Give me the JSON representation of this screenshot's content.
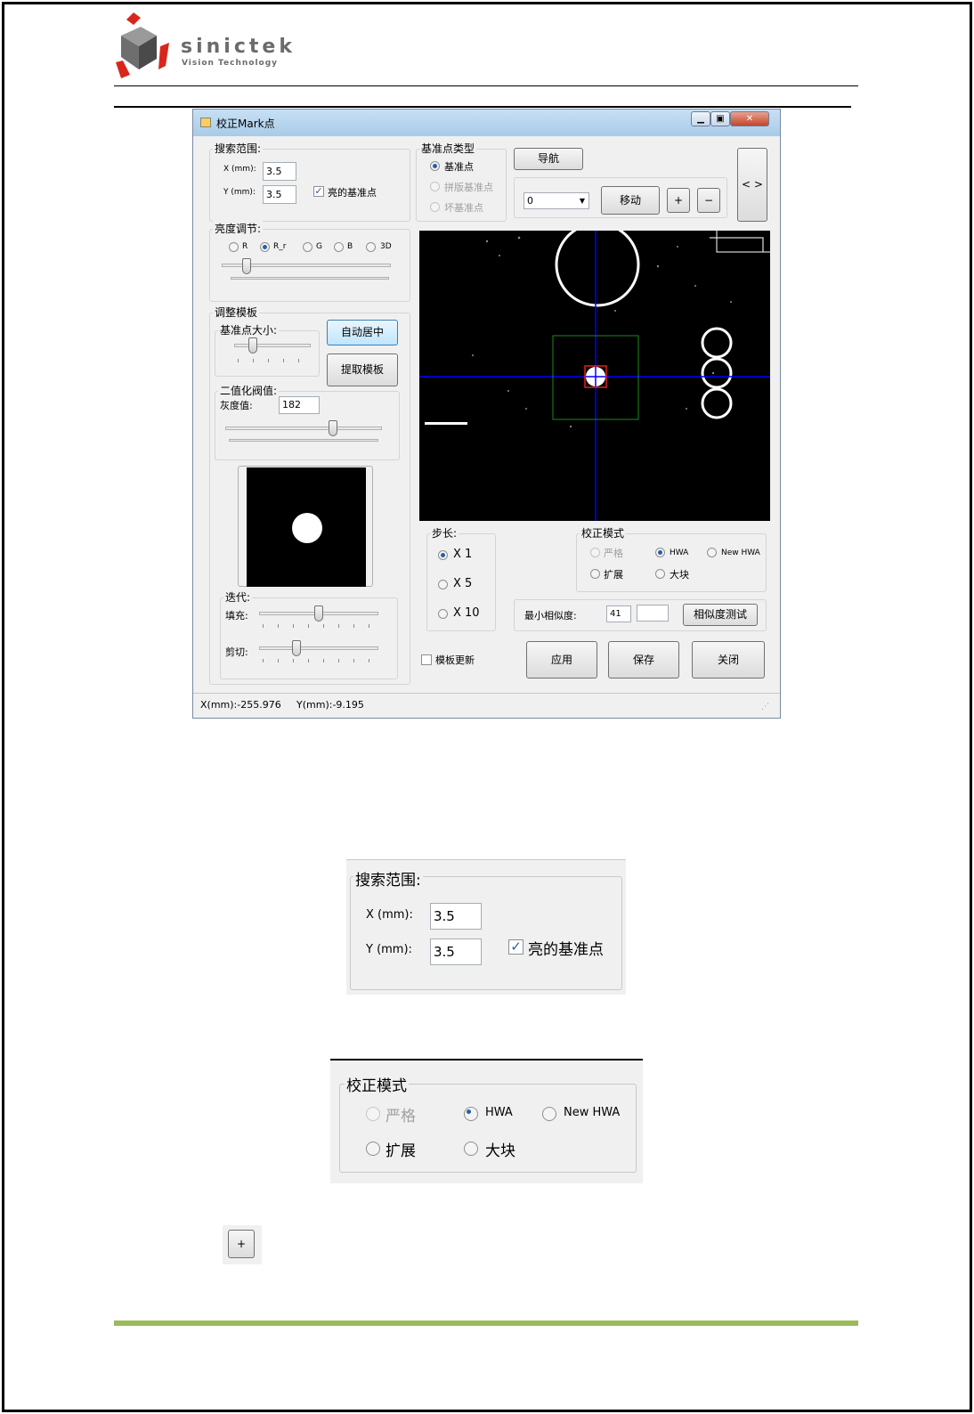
{
  "header": {
    "logo_name": "sinictek",
    "logo_tagline": "Vision Technology"
  },
  "window": {
    "title": "校正Mark点",
    "min_icon": "minimize-icon",
    "max_icon": "restore-icon",
    "close_icon": "close-icon"
  },
  "search_range": {
    "label": "搜索范围:",
    "x_label": "X (mm):",
    "x_value": "3.5",
    "y_label": "Y (mm):",
    "y_value": "3.5",
    "bright_label": "亮的基准点",
    "bright_checked": true
  },
  "fiducial_type": {
    "label": "基准点类型",
    "options": [
      "基准点",
      "拼版基准点",
      "坏基准点"
    ],
    "selected": "基准点"
  },
  "nav": {
    "navigate": "导航",
    "dropdown_value": "0",
    "move": "移动",
    "plus": "+",
    "minus": "−",
    "side_toggle": "< >"
  },
  "brightness": {
    "label": "亮度调节:",
    "options": [
      "R",
      "R_r",
      "G",
      "B",
      "3D"
    ],
    "selected": "R_r"
  },
  "template": {
    "label": "调整模板",
    "size_label": "基准点大小:",
    "auto_center": "自动居中",
    "extract": "提取模板",
    "binarize_label": "二值化阀值:",
    "gray_label": "灰度值:",
    "gray_value": "182",
    "iterate_label": "迭代:",
    "fill_label": "填充:",
    "cut_label": "剪切:"
  },
  "step": {
    "label": "步长:",
    "options": [
      "X 1",
      "X 5",
      "X 10"
    ],
    "selected": "X 1"
  },
  "correction_mode": {
    "label": "校正模式",
    "options": [
      "严格",
      "HWA",
      "New HWA",
      "扩展",
      "大块"
    ],
    "selected": "HWA"
  },
  "similarity": {
    "label": "最小相似度:",
    "value": "41",
    "result": "",
    "test": "相似度测试"
  },
  "bottom": {
    "template_update": "模板更新",
    "apply": "应用",
    "save": "保存",
    "close": "关闭"
  },
  "status": {
    "x": "X(mm):-255.976",
    "y": "Y(mm):-9.195"
  },
  "colors": {
    "footer_line": "#9bbb59",
    "logo_red": "#d9261c",
    "crosshair": "#0000ff",
    "roi_box": "#1a8c1a",
    "mark_box": "#e02020"
  }
}
